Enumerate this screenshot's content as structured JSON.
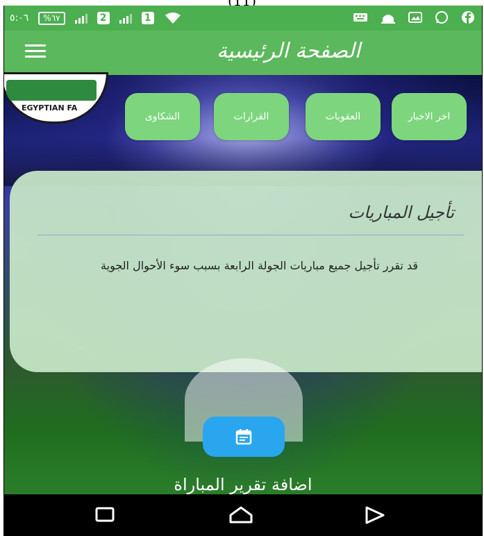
{
  "caption": "(11)",
  "status_bar": {
    "time": "٥:٠٦",
    "battery": "%٦٧"
  },
  "app_bar": {
    "title": "الصفحة الرئيسية"
  },
  "logo": {
    "text": "EGYPTIAN FA"
  },
  "category_buttons": [
    {
      "label": "اخر الاخبار"
    },
    {
      "label": "العقوبات"
    },
    {
      "label": "القرارات"
    },
    {
      "label": "الشكاوى"
    }
  ],
  "news_card": {
    "title": "تأجيل المباريات",
    "body": "قد تقرر تأجيل جميع مباريات الجولة الرابعة بسبب سوء الأحوال الجوية"
  },
  "add_report": {
    "label": "اضافة تقرير المباراة"
  },
  "colors": {
    "status_bar": "#4caf50",
    "app_bar": "#5cb85c",
    "category_button": "#7dd67d",
    "fab": "#29a6ee"
  }
}
